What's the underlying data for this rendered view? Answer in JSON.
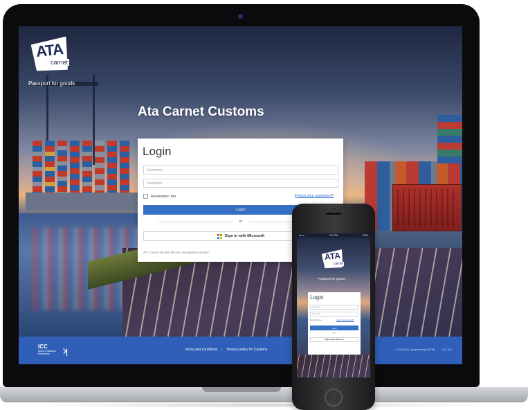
{
  "app": {
    "title": "Ata Carnet Customs",
    "logo": {
      "brand": "ATA",
      "sub": "carnet"
    },
    "tagline": "Passport for goods"
  },
  "login": {
    "heading": "Login",
    "username_placeholder": "Username",
    "password_placeholder": "Password",
    "remember_label": "Remember me",
    "forgot_label": "Forgot your password?",
    "login_button": "Login",
    "or_label": "or",
    "microsoft_button": "Sign in with Microsoft",
    "footer_text": "ATA Carnet real-time lifecycle management system"
  },
  "footer": {
    "org_short": "ICC",
    "org_name": "World Chambers Federation",
    "links": [
      "Terms and conditions",
      "Privacy policy for Customs"
    ],
    "copyright": "© 2022 ICC powered by GOITB",
    "version": "1.17.5.5"
  },
  "phone": {
    "status_left": "•••• ᯤ",
    "status_time": "4:21 PM",
    "status_right": "100%"
  },
  "colors": {
    "accent": "#3570c4",
    "footer_bg": "#2f5fb8",
    "link": "#2f6bd0"
  },
  "icons": [
    "microsoft-logo-icon",
    "icc-logo-icon",
    "ata-carnet-logo-icon",
    "camera-icon"
  ]
}
